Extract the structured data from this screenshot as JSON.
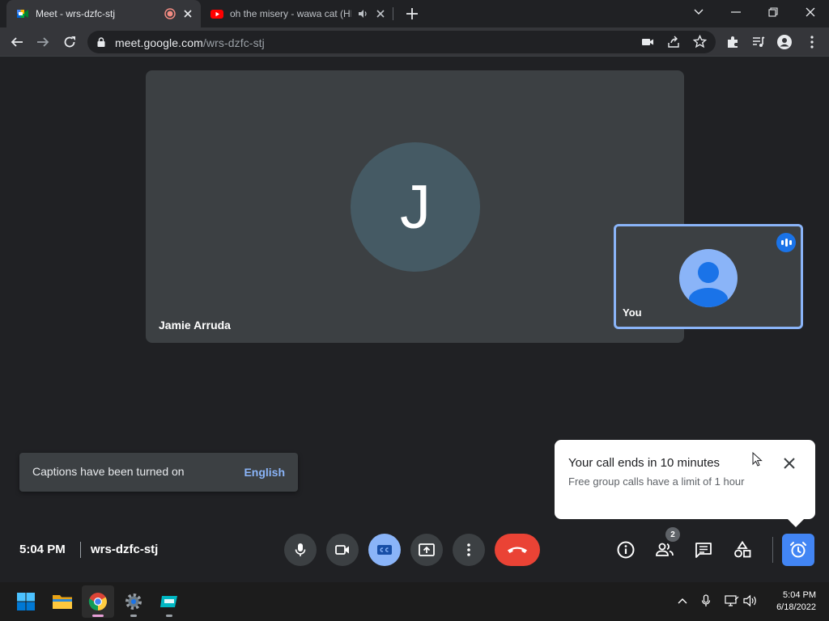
{
  "browser": {
    "tabs": [
      {
        "title": "Meet - wrs-dzfc-stj",
        "favicon": "google-meet-icon",
        "indicator": "recording-icon",
        "active": true
      },
      {
        "title": "oh the misery - wawa cat (HD",
        "favicon": "youtube-icon",
        "indicator": "speaker-audio-icon",
        "active": false
      }
    ],
    "url_host": "meet.google.com",
    "url_path": "/wrs-dzfc-stj"
  },
  "meet": {
    "main_participant": {
      "name": "Jamie Arruda",
      "initial": "J",
      "avatar_color": "#455a64"
    },
    "self_tile": {
      "name": "You",
      "border_color": "#8ab4f8"
    },
    "captions_toast": {
      "message": "Captions have been turned on",
      "language": "English"
    },
    "timer_card": {
      "title": "Your call ends in 10 minutes",
      "body": "Free group calls have a limit of 1 hour"
    },
    "time": "5:04 PM",
    "meeting_code": "wrs-dzfc-stj",
    "people_count": "2",
    "colors": {
      "end_call": "#ea4335",
      "accent": "#8ab4f8",
      "alarm": "#4285f4"
    }
  },
  "taskbar": {
    "apps": [
      "windows-start-icon",
      "file-explorer-icon",
      "chrome-icon",
      "settings-icon",
      "app-icon"
    ],
    "clock_time": "5:04 PM",
    "clock_date": "6/18/2022"
  }
}
